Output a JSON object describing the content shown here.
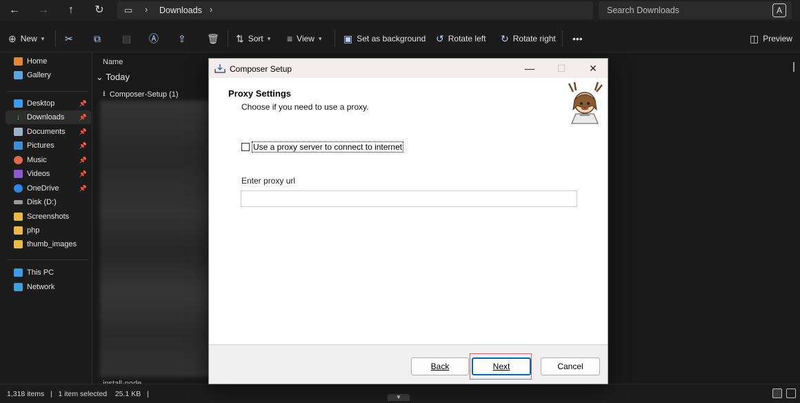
{
  "explorer": {
    "breadcrumb": {
      "current": "Downloads"
    },
    "search": {
      "placeholder": "Search Downloads"
    },
    "toolbar": {
      "new_label": "New",
      "sort_label": "Sort",
      "view_label": "View",
      "set_background_label": "Set as background",
      "rotate_left_label": "Rotate left",
      "rotate_right_label": "Rotate right",
      "preview_label": "Preview"
    },
    "sidebar": {
      "items": [
        {
          "label": "Home",
          "icon": "home-icon"
        },
        {
          "label": "Gallery",
          "icon": "gallery-icon"
        },
        {
          "label": "Desktop",
          "icon": "desktop-icon",
          "pinned": true
        },
        {
          "label": "Downloads",
          "icon": "download-icon",
          "pinned": true,
          "selected": true
        },
        {
          "label": "Documents",
          "icon": "documents-icon",
          "pinned": true
        },
        {
          "label": "Pictures",
          "icon": "pictures-icon",
          "pinned": true
        },
        {
          "label": "Music",
          "icon": "music-icon",
          "pinned": true
        },
        {
          "label": "Videos",
          "icon": "videos-icon",
          "pinned": true
        },
        {
          "label": "OneDrive",
          "icon": "cloud-icon",
          "pinned": true
        },
        {
          "label": "Disk (D:)",
          "icon": "drive-icon"
        },
        {
          "label": "Screenshots",
          "icon": "folder-icon"
        },
        {
          "label": "php",
          "icon": "folder-icon"
        },
        {
          "label": "thumb_images",
          "icon": "folder-icon"
        },
        {
          "label": "This PC",
          "icon": "pc-icon"
        },
        {
          "label": "Network",
          "icon": "network-icon"
        }
      ]
    },
    "content": {
      "column_name": "Name",
      "group": "Today",
      "file": "Composer-Setup (1)",
      "bottom_file": "install-node"
    },
    "status": {
      "items": "1,318 items",
      "selected": "1 item selected",
      "size": "25.1 KB"
    }
  },
  "dialog": {
    "title": "Composer Setup",
    "heading": "Proxy Settings",
    "subheading": "Choose if you need to use a proxy.",
    "checkbox_label": "Use a proxy server to connect to internet",
    "checkbox_checked": false,
    "proxy_label": "Enter proxy url",
    "proxy_value": "",
    "buttons": {
      "back": "Back",
      "next": "Next",
      "cancel": "Cancel"
    }
  },
  "colors": {
    "accent": "#0067c0",
    "highlight": "#e06060",
    "dark_bg": "#1c1c1c"
  }
}
